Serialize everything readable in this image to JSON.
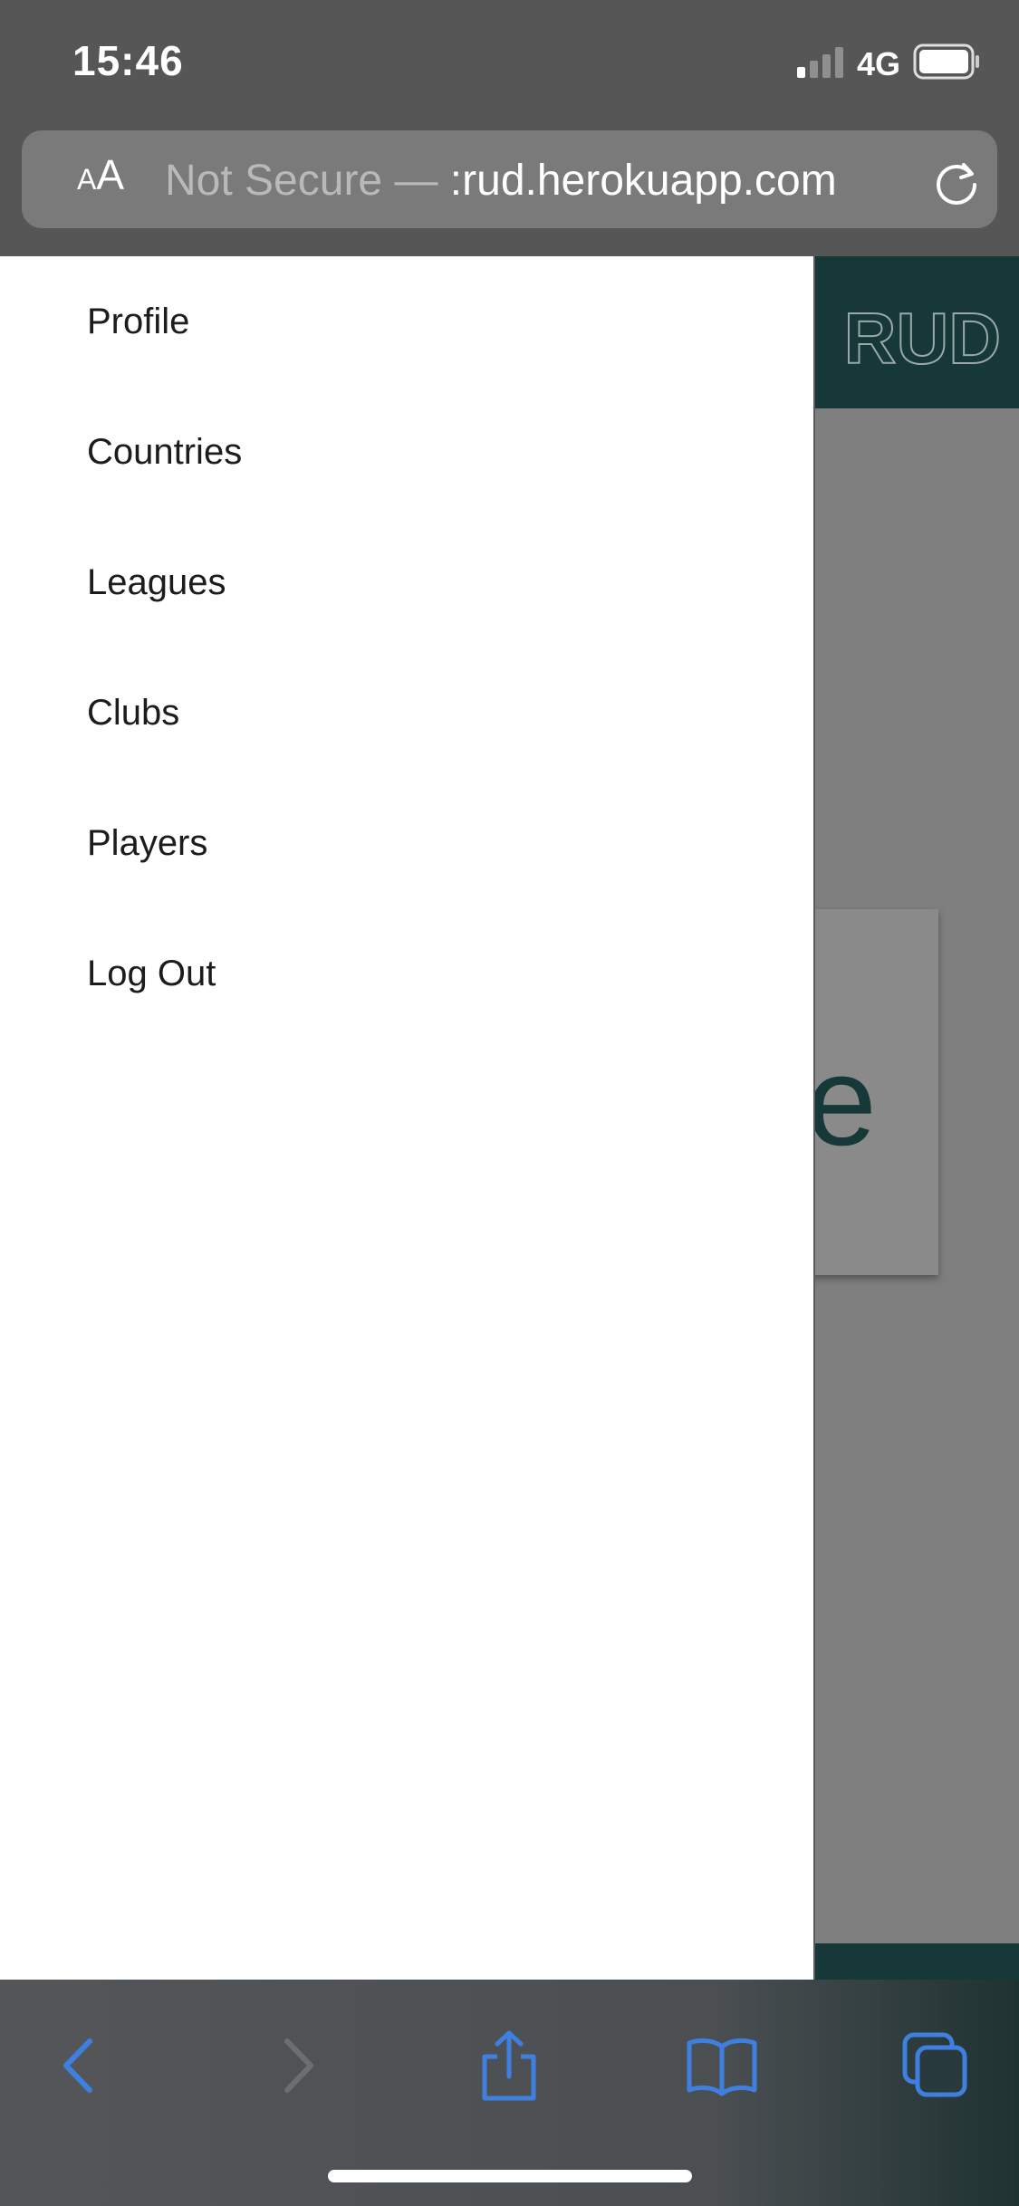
{
  "status_bar": {
    "time": "15:46",
    "network": "4G"
  },
  "url_bar": {
    "aa_small": "A",
    "aa_large": "A",
    "security_label": "Not Secure — ",
    "domain": "crud.herokuapp.com",
    "domain_visible": ":rud.herokuapp.com"
  },
  "page": {
    "logo_text": "RUD",
    "card_partial_text": "e",
    "header_color": "#163838"
  },
  "drawer": {
    "items": [
      {
        "label": "Profile"
      },
      {
        "label": "Countries"
      },
      {
        "label": "Leagues"
      },
      {
        "label": "Clubs"
      },
      {
        "label": "Players"
      },
      {
        "label": "Log Out"
      }
    ]
  },
  "toolbar": {
    "accent_color": "#3f7fe0",
    "disabled_color": "#6e6e6e",
    "icons": [
      "back-icon",
      "forward-icon",
      "share-icon",
      "bookmarks-icon",
      "tabs-icon"
    ]
  }
}
